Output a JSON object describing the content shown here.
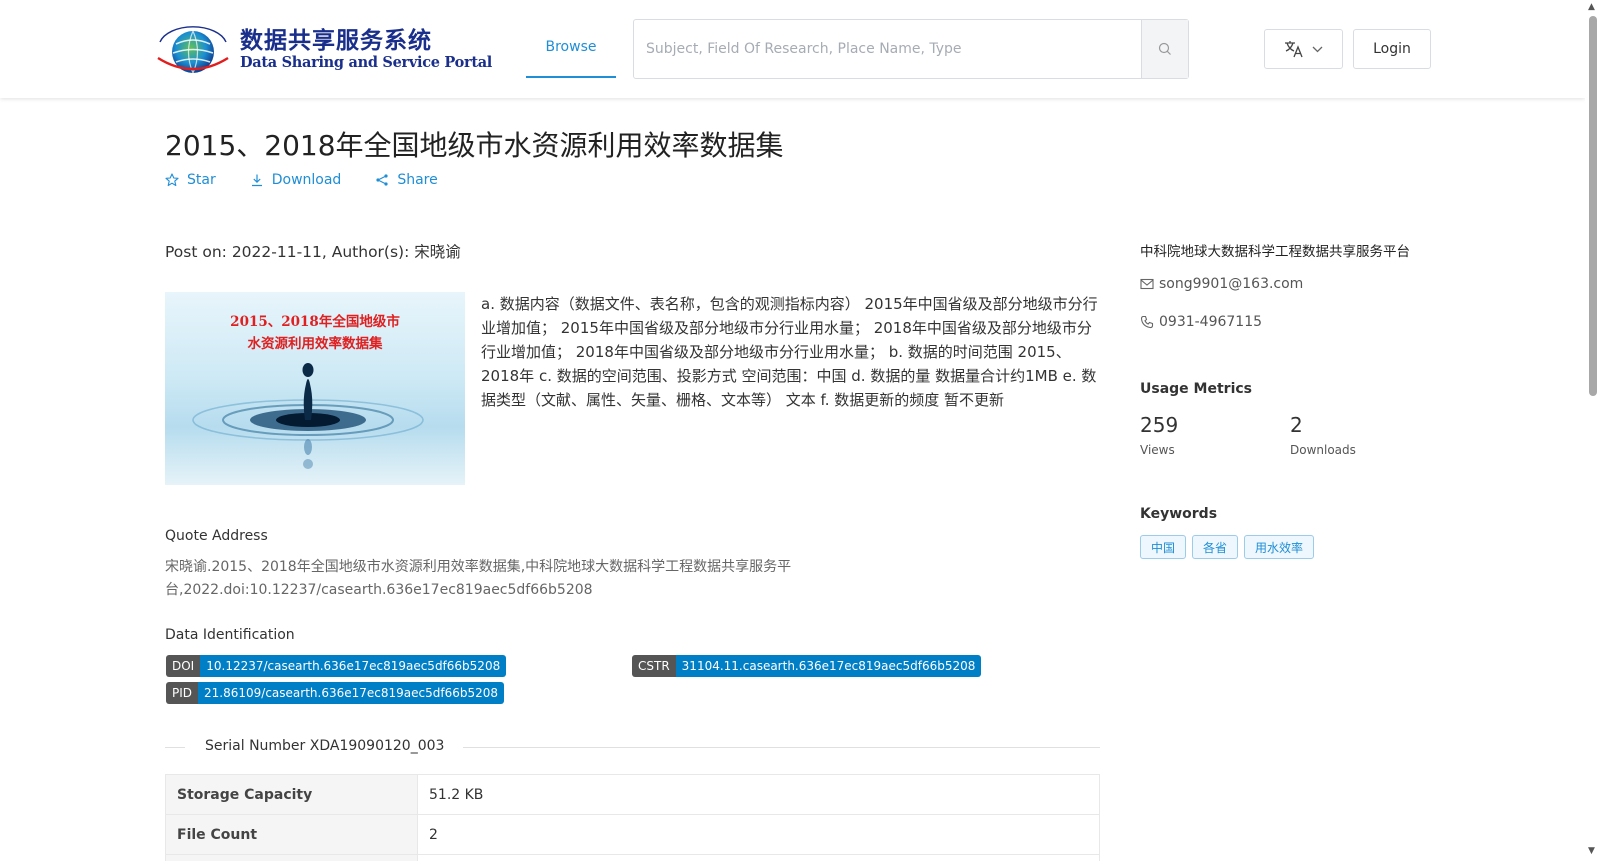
{
  "header": {
    "logo_cn": "数据共享服务系统",
    "logo_en": "Data Sharing and Service Portal",
    "nav_browse": "Browse",
    "search_placeholder": "Subject, Field Of Research, Place Name, Type",
    "login_label": "Login"
  },
  "dataset": {
    "title": "2015、2018年全国地级市水资源利用效率数据集",
    "actions": {
      "star": "Star",
      "download": "Download",
      "share": "Share"
    },
    "post_info": "Post on: 2022-11-11, Author(s): 宋晓谕",
    "thumb_line1": "2015、2018年全国地级市",
    "thumb_line2": "水资源利用效率数据集",
    "description": "a. 数据内容（数据文件、表名称，包含的观测指标内容） 2015年中国省级及部分地级市分行业增加值； 2015年中国省级及部分地级市分行业用水量； 2018年中国省级及部分地级市分行业增加值； 2018年中国省级及部分地级市分行业用水量； b. 数据的时间范围 2015、2018年 c. 数据的空间范围、投影方式 空间范围：中国 d. 数据的量 数据量合计约1MB e. 数据类型（文献、属性、矢量、栅格、文本等） 文本 f. 数据更新的频度 暂不更新",
    "quote_label": "Quote Address",
    "quote_text": "宋晓谕.2015、2018年全国地级市水资源利用效率数据集,中科院地球大数据科学工程数据共享服务平台,2022.doi:10.12237/casearth.636e17ec819aec5df66b5208",
    "identification_label": "Data Identification",
    "identifiers": {
      "doi_key": "DOI",
      "doi_value": "10.12237/casearth.636e17ec819aec5df66b5208",
      "cstr_key": "CSTR",
      "cstr_value": "31104.11.casearth.636e17ec819aec5df66b5208",
      "pid_key": "PID",
      "pid_value": "21.86109/casearth.636e17ec819aec5df66b5208"
    },
    "serial": "Serial Number XDA19090120_003",
    "info_rows": [
      {
        "key": "Storage Capacity",
        "value": "51.2 KB"
      },
      {
        "key": "File Count",
        "value": "2"
      }
    ]
  },
  "sidebar": {
    "org": "中科院地球大数据科学工程数据共享服务平台",
    "email": "song9901@163.com",
    "phone": "0931-4967115",
    "metrics_title": "Usage Metrics",
    "views_value": "259",
    "views_label": "Views",
    "downloads_value": "2",
    "downloads_label": "Downloads",
    "keywords_title": "Keywords",
    "keywords": [
      "中国",
      "各省",
      "用水效率"
    ]
  },
  "colors": {
    "accent": "#1f8ed6",
    "brand": "#1a2f8c",
    "badge_key": "#555555",
    "badge_value": "#007ec6"
  }
}
